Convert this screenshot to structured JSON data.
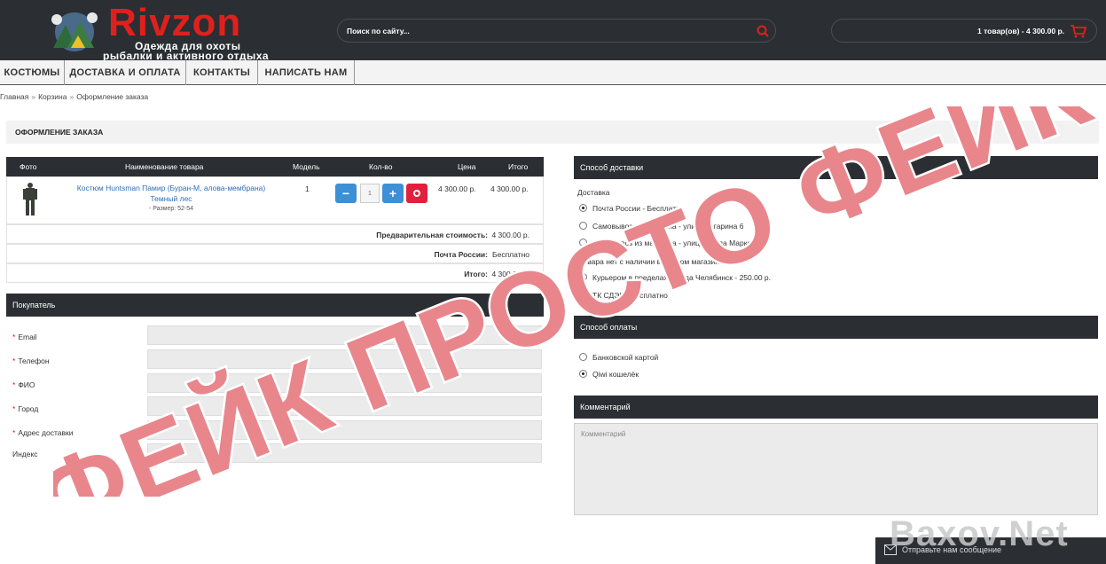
{
  "header": {
    "brand": "Rivzon",
    "tagline1": "Одежда для охоты",
    "tagline2": "рыбалки и активного отдыха",
    "search_placeholder": "Поиск по сайту...",
    "cart_summary": "1 товар(ов) - 4 300.00 р."
  },
  "nav": [
    "КОСТЮМЫ",
    "ДОСТАВКА И ОПЛАТА",
    "КОНТАКТЫ",
    "НАПИСАТЬ НАМ"
  ],
  "breadcrumb": [
    "Главная",
    "Корзина",
    "Оформление заказа"
  ],
  "page_title": "ОФОРМЛЕНИЕ ЗАКАЗА",
  "cart_table": {
    "headers": [
      "Фото",
      "Наименование товара",
      "Модель",
      "Кол-во",
      "Цена",
      "Итого"
    ],
    "item": {
      "name_line1": "Костюм Huntsman Памир (Буран-М, алова-мембрана)",
      "name_line2": "Темный лес",
      "size": "- Размер: 52-54",
      "model": "1",
      "qty": "1",
      "minus": "−",
      "plus": "+",
      "price": "4 300.00 р.",
      "total": "4 300.00 р."
    },
    "subtotal_label": "Предварительная стоимость:",
    "subtotal_value": "4 300.00 р.",
    "shipping_label": "Почта России:",
    "shipping_value": "Бесплатно",
    "total_label": "Итого:",
    "total_value": "4 300.00 р."
  },
  "buyer": {
    "title": "Покупатель",
    "fields": [
      {
        "label": "Email",
        "required": true
      },
      {
        "label": "Телефон",
        "required": true
      },
      {
        "label": "ФИО",
        "required": true
      },
      {
        "label": "Город",
        "required": true
      },
      {
        "label": "Адрес доставки",
        "required": true
      },
      {
        "label": "Индекс",
        "required": false
      }
    ],
    "required_mark": "*"
  },
  "delivery": {
    "title": "Способ доставки",
    "group_label": "Доставка",
    "options": [
      "Почта России - Бесплатно",
      "Самовывоз из магазина - улица Гагарина 6",
      "Самовывоз из магазина - улица Карла Маркса 73"
    ],
    "note": "Товара нет с наличии в данном магазине",
    "options2": [
      "Курьером в пределах города Челябинск - 250.00 р.",
      "ТК СДЭК - Бесплатно"
    ],
    "selected": 0
  },
  "payment": {
    "title": "Способ оплаты",
    "options": [
      "Банковской картой",
      "Qiwi кошелёк"
    ],
    "selected": 1
  },
  "comment": {
    "title": "Комментарий",
    "placeholder": "Комментарий"
  },
  "chat": {
    "text": "Отправьте нам сообщение"
  },
  "watermarks": {
    "big": "ФЕЙК ПРОСТО ФЕЙК",
    "site": "Baxov.Net"
  },
  "colors": {
    "dark": "#2b2f33",
    "accent_red": "#e0201c",
    "blue": "#3d8fd6",
    "link": "#2a6ebb"
  }
}
